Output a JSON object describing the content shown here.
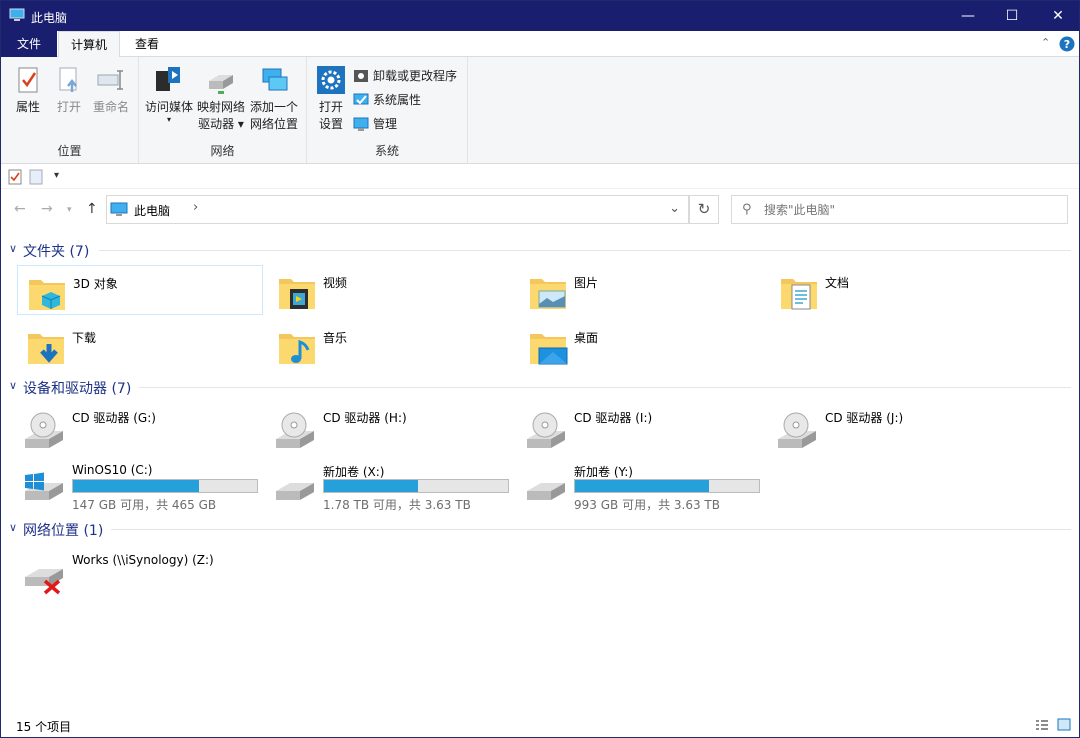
{
  "window": {
    "title": "此电脑"
  },
  "tabs": {
    "file": "文件",
    "computer": "计算机",
    "view": "查看"
  },
  "ribbon": {
    "location": {
      "name": "位置",
      "properties": "属性",
      "open": "打开",
      "rename": "重命名"
    },
    "network": {
      "name": "网络",
      "media_line1": "访问媒体",
      "map_line1": "映射网络",
      "map_line2": "驱动器 ▾",
      "add_line1": "添加一个",
      "add_line2": "网络位置"
    },
    "system": {
      "name": "系统",
      "open_line1": "打开",
      "open_line2": "设置",
      "uninstall": "卸载或更改程序",
      "sysprops": "系统属性",
      "manage": "管理"
    }
  },
  "address": {
    "crumb": "此电脑",
    "search_placeholder": "搜索\"此电脑\""
  },
  "groups": {
    "folders": "文件夹 (7)",
    "devices": "设备和驱动器 (7)",
    "network": "网络位置 (1)"
  },
  "folders": [
    "3D 对象",
    "视频",
    "图片",
    "文档",
    "下载",
    "音乐",
    "桌面"
  ],
  "cd_drives": [
    "CD 驱动器 (G:)",
    "CD 驱动器 (H:)",
    "CD 驱动器 (I:)",
    "CD 驱动器 (J:)"
  ],
  "disks": [
    {
      "name": "WinOS10 (C:)",
      "free": "147 GB 可用，共 465 GB",
      "used_fraction": 0.684
    },
    {
      "name": "新加卷 (X:)",
      "free": "1.78 TB 可用，共 3.63 TB",
      "used_fraction": 0.51
    },
    {
      "name": "新加卷 (Y:)",
      "free": "993 GB 可用，共 3.63 TB",
      "used_fraction": 0.727
    }
  ],
  "network_locations": [
    "Works (\\\\iSynology) (Z:)"
  ],
  "status": {
    "count": "15 个项目"
  },
  "colors": {
    "titlebar": "#1a1e6e",
    "accent": "#26a0da",
    "group_header": "#1e3287"
  }
}
